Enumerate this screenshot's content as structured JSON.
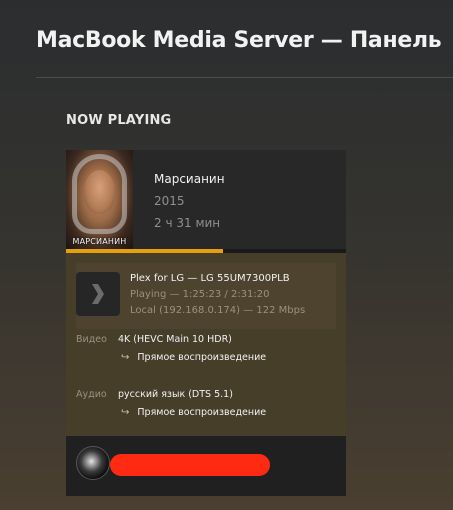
{
  "page": {
    "title": "MacBook Media Server — Панель"
  },
  "now_playing": {
    "section_title": "NOW PLAYING",
    "poster_caption": "МАРСИАНИН",
    "title": "Марсианин",
    "year": "2015",
    "duration": "2 ч 31 мин",
    "progress_fraction": 0.56,
    "progress_color": "#e5a00d",
    "player": {
      "icon": "plex-chevron-icon",
      "name": "Plex for LG  —  LG 55UM7300PLB",
      "state": "Playing — 1:25:23 / 2:31:20",
      "network": "Local (192.168.0.174) — 122 Mbps"
    },
    "video": {
      "label": "Видео",
      "value": "4K (HEVC Main 10 HDR)",
      "decision": "Прямое воспроизведение"
    },
    "audio": {
      "label": "Аудио",
      "value": "русский язык (DTS 5.1)",
      "decision": "Прямое воспроизведение"
    },
    "user": {
      "avatar": "user-avatar",
      "name_redacted": true
    }
  }
}
